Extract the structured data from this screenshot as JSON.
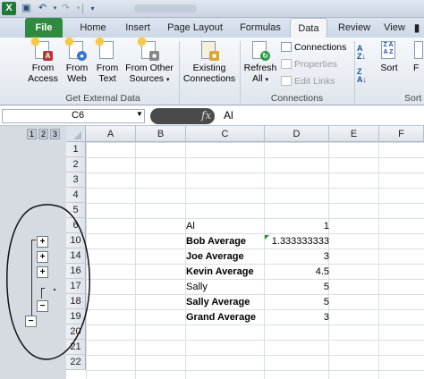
{
  "title_bar": {
    "app_icon": "X"
  },
  "tabs": [
    "File",
    "Home",
    "Insert",
    "Page Layout",
    "Formulas",
    "Data",
    "Review",
    "View"
  ],
  "ribbon": {
    "buttons": [
      {
        "line1": "From",
        "line2": "Access",
        "icon": "access-icon"
      },
      {
        "line1": "From",
        "line2": "Web",
        "icon": "web-icon"
      },
      {
        "line1": "From",
        "line2": "Text",
        "icon": "text-icon"
      },
      {
        "line1": "From Other",
        "line2": "Sources",
        "icon": "other-sources-icon"
      },
      {
        "line1": "Existing",
        "line2": "Connections",
        "icon": "connections-icon"
      },
      {
        "line1": "Refresh",
        "line2": "All",
        "icon": "refresh-icon"
      },
      {
        "line1": "Sort",
        "line2": "",
        "icon": "sort-icon"
      },
      {
        "line1": "F",
        "line2": "",
        "icon": "filter-icon"
      }
    ],
    "connections_group": {
      "connections": "Connections",
      "properties": "Properties",
      "edit_links": "Edit Links"
    },
    "groups": {
      "get_external": "Get External Data",
      "connections": "Connections",
      "sort": "Sort"
    }
  },
  "formula_bar": {
    "name_box": "C6",
    "fx": "fx",
    "value": "Al"
  },
  "outline_levels": [
    "1",
    "2",
    "3"
  ],
  "columns": [
    "A",
    "B",
    "C",
    "D",
    "E",
    "F"
  ],
  "rows": [
    "1",
    "2",
    "3",
    "4",
    "5",
    "6",
    "10",
    "14",
    "16",
    "17",
    "18",
    "19",
    "20",
    "21",
    "22"
  ],
  "cells": [
    {
      "label": "Al",
      "value": "1",
      "bold": false
    },
    {
      "label": "Bob Average",
      "value": "1.333333333",
      "bold": true
    },
    {
      "label": "Joe Average",
      "value": "3",
      "bold": true
    },
    {
      "label": "Kevin Average",
      "value": "4.5",
      "bold": true
    },
    {
      "label": "Sally",
      "value": "5",
      "bold": false
    },
    {
      "label": "Sally Average",
      "value": "5",
      "bold": true
    },
    {
      "label": "Grand Average",
      "value": "3",
      "bold": true
    }
  ],
  "outline_buttons": {
    "plus": "+",
    "minus": "−"
  }
}
